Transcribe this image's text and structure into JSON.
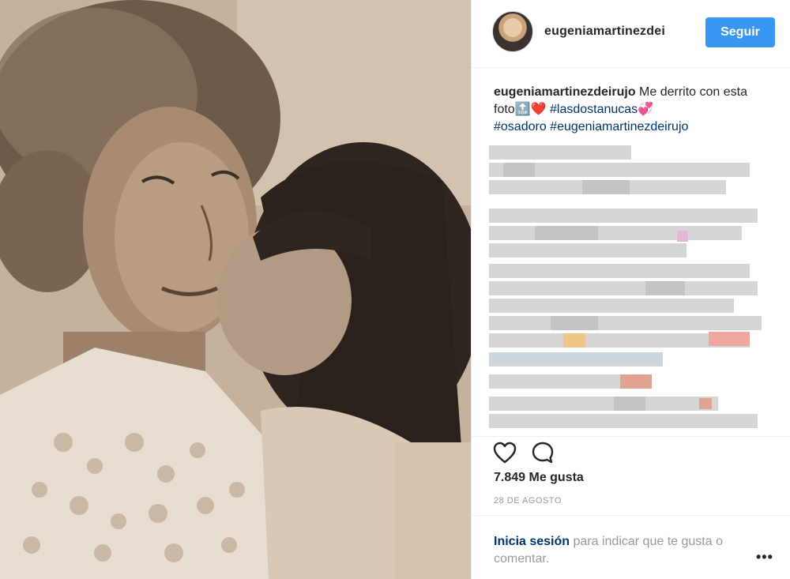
{
  "post": {
    "username": "eugeniamartinezdei",
    "follow_label": "Seguir",
    "caption": {
      "user": "eugeniamartinezdeirujo",
      "text": "Me derrito con esta foto",
      "emoji_top": "🔝",
      "emoji_heart": "❤️",
      "hashtag1": "#lasdostanucas",
      "emoji_hearts": "💞",
      "hashtag2": "#osadoro",
      "hashtag3": "#eugeniamartinezdeirujo"
    },
    "likes": "7.849 Me gusta",
    "date": "28 DE AGOSTO",
    "login": {
      "link": "Inicia sesión",
      "rest": "para indicar que te gusta o comentar."
    },
    "more_label": "•••",
    "icons": {
      "like": "heart-outline-icon",
      "comment": "comment-bubble-icon"
    },
    "colors": {
      "accent": "#3897f0",
      "link": "#003569",
      "muted": "#999999"
    }
  }
}
